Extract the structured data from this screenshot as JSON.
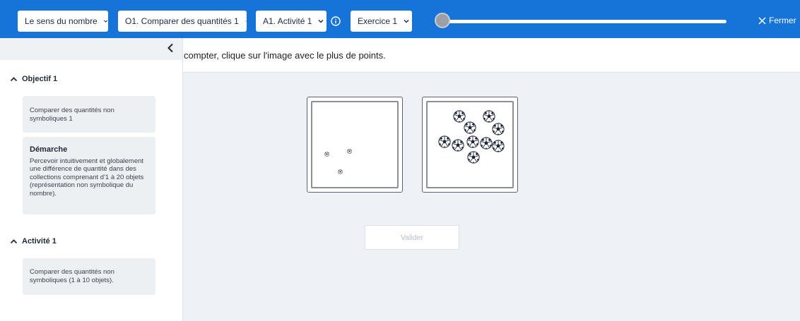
{
  "toolbar": {
    "domain_select": "Le sens du nombre",
    "objective_select": "O1. Comparer des quantités 1",
    "activity_select": "A1. Activité 1",
    "exercise_select": "Exercice 1",
    "progress_fraction": 0,
    "close_label": "Fermer",
    "accent_color": "#1673d8"
  },
  "instruction": {
    "text": "compter, clique sur l'image avec le plus de points."
  },
  "sidebar": {
    "objective_header": "Objectif 1",
    "objective_card": "Comparer des quantités non symboliques 1",
    "approach_title": "Démarche",
    "approach_text": "Percevoir intuitivement et globalement une différence de quantité dans des collections comprenant d'1 à 20 objets (représentation non symbolique du nombre).",
    "activity_header": "Activité 1",
    "activity_card": "Comparer des quantités non symboliques (1 à 10 objets)."
  },
  "choices": [
    {
      "ball_count": 3,
      "ball_icon": "soccer-ball-icon"
    },
    {
      "ball_count": 10,
      "ball_icon": "soccer-ball-icon"
    }
  ],
  "validate_label": "Valider"
}
